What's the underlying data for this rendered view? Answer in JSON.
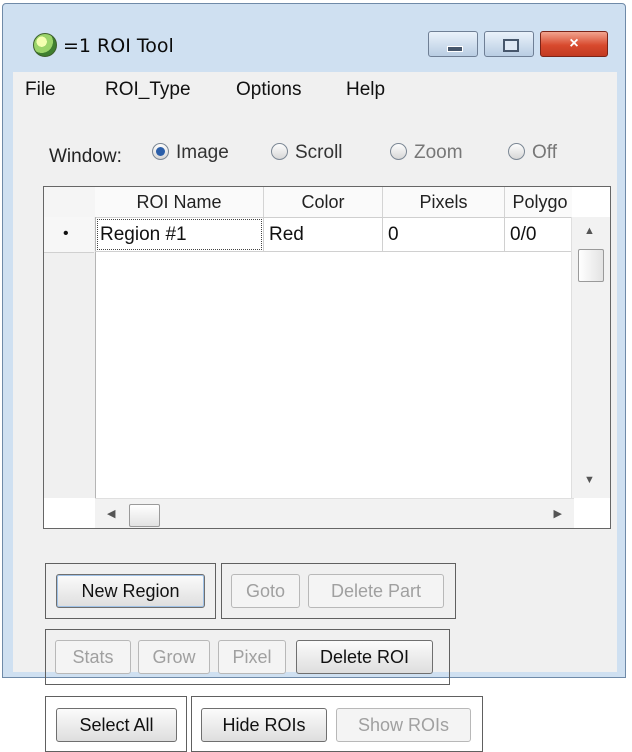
{
  "window": {
    "title": "=1 ROI Tool",
    "icon": "idl-globe-icon",
    "controls": {
      "minimize": "minimize-icon",
      "maximize": "maximize-icon",
      "close": "×"
    }
  },
  "menubar": {
    "items": [
      "File",
      "ROI_Type",
      "Options",
      "Help"
    ]
  },
  "window_mode": {
    "label": "Window:",
    "options": [
      {
        "label": "Image",
        "selected": true,
        "enabled": true
      },
      {
        "label": "Scroll",
        "selected": false,
        "enabled": true
      },
      {
        "label": "Zoom",
        "selected": false,
        "enabled": false
      },
      {
        "label": "Off",
        "selected": false,
        "enabled": false
      }
    ]
  },
  "table": {
    "columns": [
      "ROI Name",
      "Color",
      "Pixels",
      "Polygo"
    ],
    "rows": [
      {
        "marker": "•",
        "name": "Region #1",
        "color": "Red",
        "pixels": "0",
        "polygons": "0/0"
      }
    ]
  },
  "buttons": {
    "group1": {
      "new_region": "New Region"
    },
    "group2": {
      "goto": "Goto",
      "delete_part": "Delete Part"
    },
    "group3": {
      "stats": "Stats",
      "grow": "Grow",
      "pixel": "Pixel",
      "delete_roi": "Delete ROI"
    },
    "group4": {
      "select_all": "Select All"
    },
    "group5": {
      "hide_rois": "Hide ROIs",
      "show_rois": "Show ROIs"
    }
  },
  "colors": {
    "frame": "#cfe0f1",
    "panel": "#f0f0f0",
    "radio_selected": "#2a5ea9",
    "close_button": "#d84a2e"
  }
}
